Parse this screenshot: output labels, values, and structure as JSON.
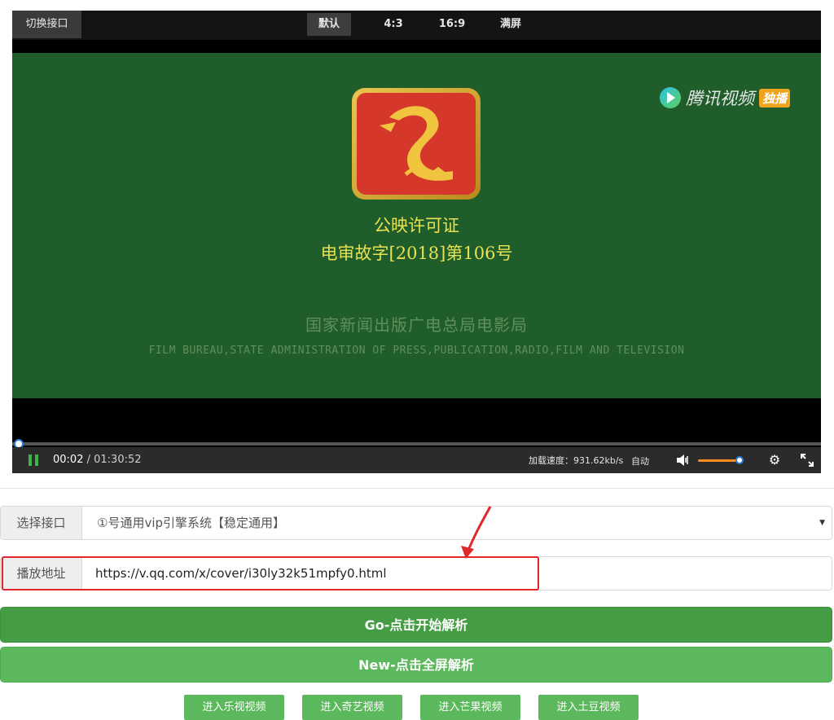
{
  "player": {
    "switch_label": "切换接口",
    "ratios": [
      "默认",
      "4:3",
      "16:9",
      "满屏"
    ],
    "active_ratio": "默认",
    "overlay": {
      "brand": "腾讯视频",
      "brand_tag": "独播",
      "license_title": "公映许可证",
      "license_no": "电审故字[2018]第106号",
      "bureau_cn": "国家新闻出版广电总局电影局",
      "bureau_en": "FILM BUREAU,STATE ADMINISTRATION OF PRESS,PUBLICATION,RADIO,FILM AND TELEVISION"
    },
    "current_time": "00:02",
    "separator": " / ",
    "duration": "01:30:52",
    "speed": "加载速度：931.62kb/s",
    "quality": "自动",
    "playback_progress": 0.0004,
    "volume_level": 0.85,
    "colors": {
      "screen_bg": "#1f5d2a",
      "license_text": "#e8e153",
      "progress_knob": "#2a7cd6",
      "volume": "#ff8a1d"
    }
  },
  "form": {
    "interface_label": "选择接口",
    "interface_value": "①号通用vip引擎系统【稳定通用】",
    "url_label": "播放地址",
    "url_value": "https://v.qq.com/x/cover/i30ly32k51mpfy0.html"
  },
  "buttons": {
    "go": "Go-点击开始解析",
    "new": "New-点击全屏解析"
  },
  "sites": [
    "进入乐视视频",
    "进入奇艺视频",
    "进入芒果视频",
    "进入土豆视频"
  ],
  "accent": {
    "green_dark": "#449d44",
    "green": "#5cb85c",
    "highlight_red": "#e0282b"
  }
}
